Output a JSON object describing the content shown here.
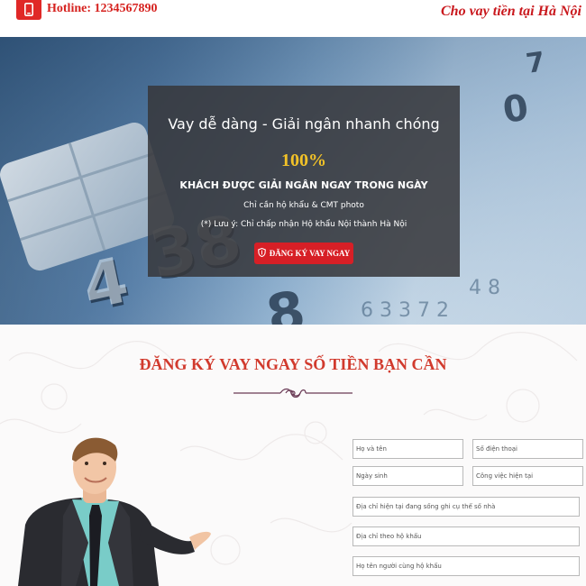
{
  "header": {
    "hotline": "Hotline: 1234567890",
    "tagline": "Cho vay tiền tại Hà Nội",
    "phone_icon": "mobile-phone-icon",
    "accent_color": "#e02827"
  },
  "hero": {
    "title": "Vay dễ dàng - Giải ngân nhanh chóng",
    "percent": "100%",
    "headline": "KHÁCH ĐƯỢC GIẢI NGÂN NGAY TRONG NGÀY",
    "note1": "Chỉ cần hộ khẩu & CMT photo",
    "note2": "(*) Lưu ý: Chỉ chấp nhận Hộ khẩu Nội thành Hà Nội",
    "button_label": "ĐĂNG KÝ VAY NGAY",
    "button_icon": "shield-icon",
    "percent_color": "#f2c228",
    "button_color": "#d71f26"
  },
  "form": {
    "title": "ĐĂNG KÝ VAY NGAY SỐ TIỀN BẠN CẦN",
    "title_color": "#d13a2d",
    "fields": {
      "name": "Họ và tên",
      "phone": "Số điện thoại",
      "dob": "Ngày sinh",
      "job": "Công việc hiện tại",
      "current_address": "Địa chỉ hiện tại đang sống ghi cụ thể số nhà",
      "household_address": "Địa chỉ theo hộ khẩu",
      "household_owner": "Họ tên người cùng hộ khẩu"
    }
  }
}
